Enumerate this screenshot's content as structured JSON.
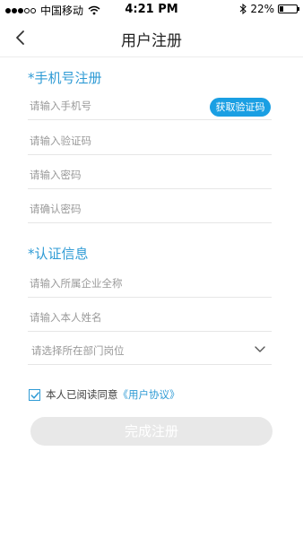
{
  "status_bar": {
    "carrier": "中国移动",
    "time": "4:21 PM",
    "battery": "22%",
    "battery_level": 0.22
  },
  "nav": {
    "title": "用户注册",
    "back_icon": "chevron-left-icon"
  },
  "phone_section": {
    "title": "*手机号注册",
    "phone_placeholder": "请输入手机号",
    "get_code_label": "获取验证码",
    "code_placeholder": "请输入验证码",
    "password_placeholder": "请输入密码",
    "confirm_password_placeholder": "请确认密码"
  },
  "verify_section": {
    "title": "*认证信息",
    "company_placeholder": "请输入所属企业全称",
    "name_placeholder": "请输入本人姓名",
    "department_select": "请选择所在部门岗位"
  },
  "agreement": {
    "checked": true,
    "text": "本人已阅读同意",
    "link": "《用户协议》"
  },
  "submit": {
    "label": "完成注册"
  },
  "colors": {
    "accent": "#2f9bd5",
    "button_blue": "#1a9fe3",
    "disabled_button": "#e8e8e8"
  }
}
